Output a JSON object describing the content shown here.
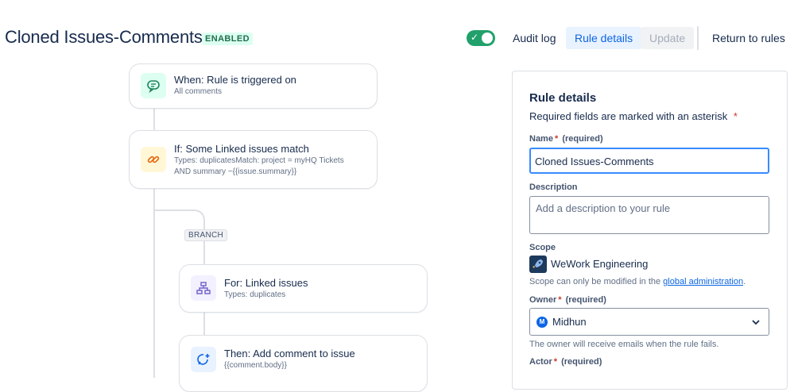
{
  "header": {
    "title": "Cloned Issues-Comments",
    "status_badge": "ENABLED",
    "toggle_checked": true,
    "audit_log_label": "Audit log",
    "rule_details_label": "Rule details",
    "update_label": "Update",
    "return_label": "Return to rules"
  },
  "flow": {
    "trigger": {
      "title": "When: Rule is triggered on",
      "subtitle": "All comments",
      "icon": "comment-trigger-icon"
    },
    "condition": {
      "title": "If: Some Linked issues match",
      "subtitle_line1": "Types: duplicatesMatch: project = myHQ Tickets",
      "subtitle_line2": "AND summary ~{{issue.summary}}",
      "icon": "link-icon"
    },
    "branch_label": "BRANCH",
    "branch_for": {
      "title": "For: Linked issues",
      "subtitle": "Types: duplicates",
      "icon": "hierarchy-icon"
    },
    "action": {
      "title": "Then: Add comment to issue",
      "subtitle": "{{comment.body}}",
      "icon": "add-comment-icon"
    }
  },
  "panel": {
    "heading": "Rule details",
    "required_note": "Required fields are marked with an asterisk",
    "asterisk": "*",
    "name_label": "Name",
    "required_suffix": "(required)",
    "name_value": "Cloned Issues-Comments",
    "description_label": "Description",
    "description_placeholder": "Add a description to your rule",
    "scope_label": "Scope",
    "scope_value": "WeWork Engineering",
    "scope_hint_prefix": "Scope can only be modified in the",
    "scope_hint_link": "global administration",
    "scope_hint_suffix": ".",
    "owner_label": "Owner",
    "owner_value": "Midhun",
    "owner_avatar": "M",
    "owner_hint": "The owner will receive emails when the rule fails.",
    "actor_label": "Actor"
  },
  "colors": {
    "accent": "#0c66e4",
    "success": "#22a06b",
    "required": "#c9372c"
  }
}
